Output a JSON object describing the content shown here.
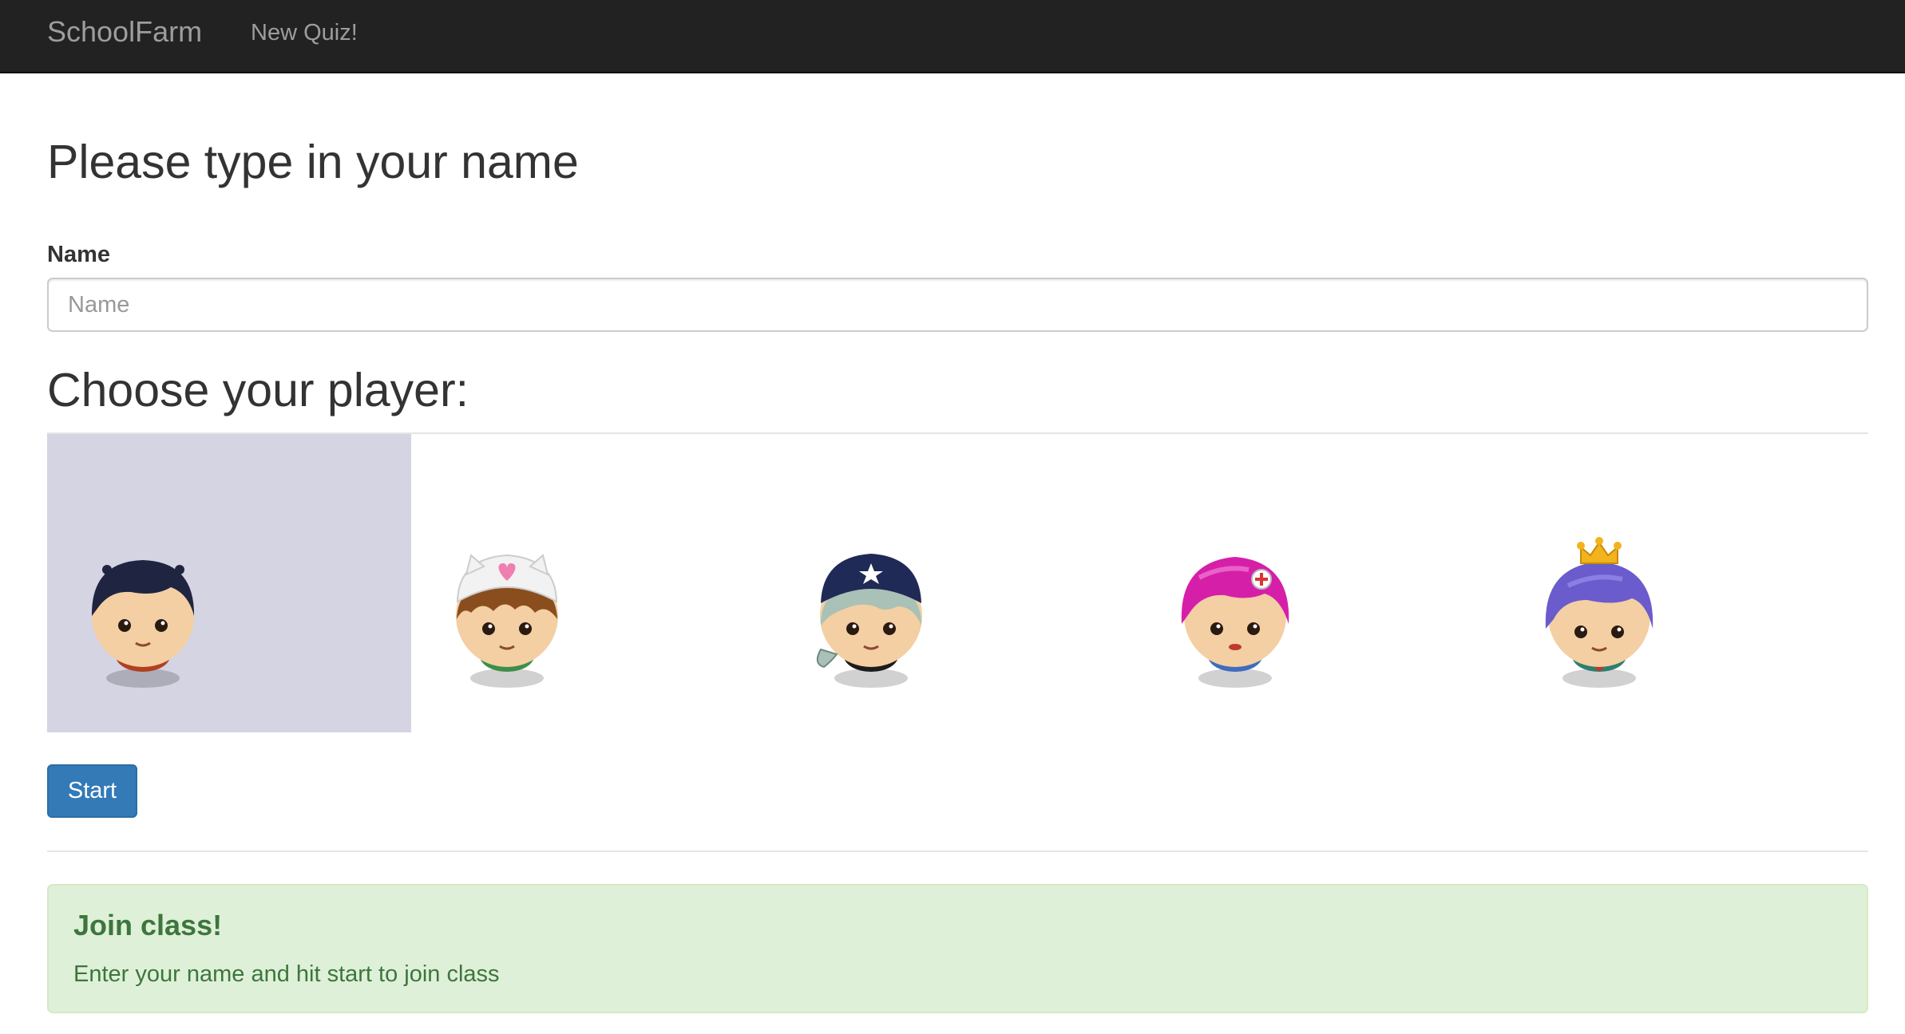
{
  "navbar": {
    "brand": "SchoolFarm",
    "link": "New Quiz!"
  },
  "form": {
    "heading": "Please type in your name",
    "name_label": "Name",
    "name_placeholder": "Name",
    "name_value": ""
  },
  "players": {
    "heading": "Choose your player:",
    "selected_index": 0,
    "items": [
      {
        "icon": "boy-dark-hair-avatar-icon",
        "hair_color": "#1f2540",
        "shirt_color": "#b04020"
      },
      {
        "icon": "cat-hat-avatar-icon",
        "hair_color": "#8a4e1e",
        "shirt_color": "#3e8e4a",
        "hat_color": "#f2f2f2"
      },
      {
        "icon": "pirate-avatar-icon",
        "hair_color": "#a9c1b6",
        "shirt_color": "#1c1c1c",
        "hat_color": "#1f2a56"
      },
      {
        "icon": "pink-hair-avatar-icon",
        "hair_color": "#d61fa9",
        "shirt_color": "#3f6dbd"
      },
      {
        "icon": "princess-crown-avatar-icon",
        "hair_color": "#6a5ccc",
        "shirt_color": "#2e7f6f",
        "crown_color": "#f2b41c"
      }
    ]
  },
  "actions": {
    "start_label": "Start"
  },
  "alert": {
    "title": "Join class!",
    "message": "Enter your name and hit start to join class"
  }
}
